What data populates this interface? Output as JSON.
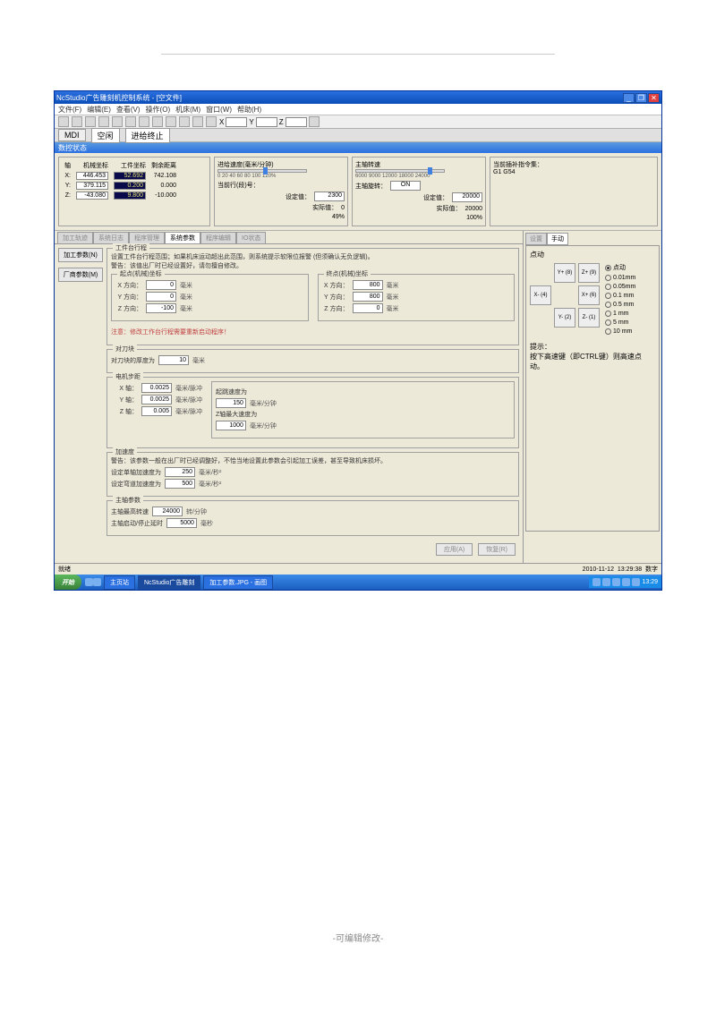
{
  "titlebar": {
    "title": "NcStudio广告雕刻机控制系统  - [空文件]"
  },
  "menubar": [
    "文件(F)",
    "编辑(E)",
    "查看(V)",
    "操作(O)",
    "机床(M)",
    "窗口(W)",
    "帮助(H)"
  ],
  "coordbar": {
    "labels": [
      "X",
      "Y",
      "Z"
    ]
  },
  "mdi": {
    "label": "MDI",
    "idle": "空闲",
    "stop": "进给终止"
  },
  "section_header": "数控状态",
  "axes": {
    "header": [
      "轴",
      "机械坐标",
      "工件坐标",
      "剩余距离"
    ],
    "rows": [
      {
        "ax": "X:",
        "m": "446.453",
        "w": "52.692",
        "r": "742.108"
      },
      {
        "ax": "Y:",
        "m": "379.115",
        "w": "0.200",
        "r": "0.000"
      },
      {
        "ax": "Z:",
        "m": "-43.080",
        "w": "9.800",
        "r": "-10.000"
      }
    ]
  },
  "feed": {
    "title": "进给速度(毫米/分钟)",
    "set_lbl": "设定值：",
    "set_val": "2300",
    "act_lbl": "实际值：",
    "act_val": "0",
    "pct": "49%",
    "line_lbl": "当前行(段)号：",
    "line_val": ""
  },
  "spindle": {
    "title": "主轴转速",
    "ticks": "6000  9000 12000 18000  24000",
    "set_lbl": "设定值：",
    "set_val": "20000",
    "act_lbl": "实际值：",
    "act_val": "20000",
    "pct": "100%",
    "rot_lbl": "主轴旋转：",
    "rot_val": "ON"
  },
  "cmdset": {
    "title": "当前插补指令集：",
    "val": "G1 G54"
  },
  "tabs": [
    "加工轨迹",
    "系统日志",
    "程序管理",
    "系统参数",
    "程序编辑",
    "IO状态"
  ],
  "active_tab": "系统参数",
  "sidebtns": {
    "s1": "加工参数(N)",
    "s2": "厂商参数(M)"
  },
  "travel": {
    "legend": "工件台行程",
    "note": "设置工件台行程范围；如果机床运动超出此范围，则系统提示软限位报警 (但须确认无负逻辑)。\n警告：该值出厂时已经设置好，请勿擅自修改。",
    "start_legend": "起点(机械)坐标",
    "end_legend": "终点(机械)坐标",
    "xdir": "X 方向：",
    "ydir": "Y 方向：",
    "zdir": "Z 方向：",
    "sx": "0",
    "sy": "0",
    "sz": "-100",
    "ex": "800",
    "ey": "800",
    "ez": "0",
    "unit": "毫米",
    "warn": "注意：修改工作台行程需要重新启动程序！"
  },
  "tool": {
    "legend": "对刀块",
    "lbl": "对刀块的厚度为",
    "val": "10",
    "unit": "毫米"
  },
  "motor": {
    "legend": "电机步距",
    "x_lbl": "X 轴：",
    "x_val": "0.0025",
    "y_lbl": "Y 轴：",
    "y_val": "0.0025",
    "z_lbl": "Z 轴：",
    "z_val": "0.005",
    "unit": "毫米/脉冲",
    "start_lbl": "起跳速度为",
    "start_val": "150",
    "start_unit": "毫米/分钟",
    "zmax_lbl": "Z轴最大速度为",
    "zmax_val": "1000",
    "zmax_unit": "毫米/分钟"
  },
  "accel": {
    "legend": "加速度",
    "note": "警告：该参数一般在出厂时已经调整好，不恰当地设置此参数会引起加工误差，甚至导致机床损坏。",
    "s1_lbl": "设定单轴加速度为",
    "s1_val": "250",
    "unit": "毫米/秒²",
    "s2_lbl": "设定弯道加速度为",
    "s2_val": "500"
  },
  "spindle_param": {
    "legend": "主轴参数",
    "max_lbl": "主轴最高转速",
    "max_val": "24000",
    "max_unit": "转/分钟",
    "delay_lbl": "主轴启动/停止延时",
    "delay_val": "5000",
    "delay_unit": "毫秒"
  },
  "buttons": {
    "apply": "应用(A)",
    "reset": "恢复(R)"
  },
  "right": {
    "tabs": [
      "设置",
      "手动"
    ],
    "mode_lbl": "点动",
    "jog": [
      "Y+\n(8)",
      "Z+\n(9)",
      "X-\n(4)",
      "X+\n(6)",
      "Y-\n(2)",
      "Z-\n(1)"
    ],
    "radios": [
      "点动",
      "0.01mm",
      "0.05mm",
      "0.1 mm",
      "0.5 mm",
      "1   mm",
      "5   mm",
      "10  mm"
    ],
    "tip_title": "提示：",
    "tip": "按下高速键（即CTRL键）则高速点动。"
  },
  "statusbar": {
    "left": "就绪",
    "date": "2010-11-12",
    "time": "13:29:38",
    "caps": "数字"
  },
  "taskbar": {
    "start": "开始",
    "items": [
      "主页站",
      "NcStudio广告雕刻",
      "加工参数.JPG - 画图"
    ],
    "time": "13:29"
  },
  "footnote": "-可编辑修改-"
}
